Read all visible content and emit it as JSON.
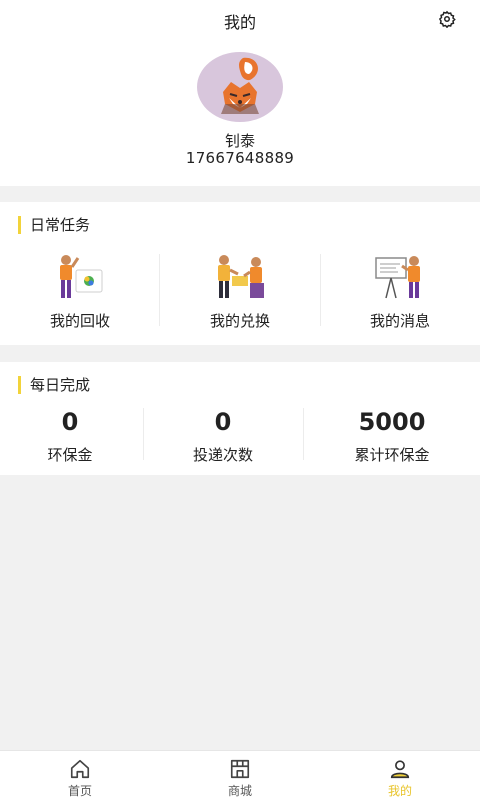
{
  "header": {
    "title": "我的",
    "username": "钊泰",
    "phone": "17667648889"
  },
  "tasks": {
    "section_title": "日常任务",
    "items": [
      {
        "label": "我的回收",
        "icon": "recycle-illustration-icon"
      },
      {
        "label": "我的兑换",
        "icon": "exchange-illustration-icon"
      },
      {
        "label": "我的消息",
        "icon": "message-illustration-icon"
      }
    ]
  },
  "daily": {
    "section_title": "每日完成",
    "stats": [
      {
        "value": "0",
        "label": "环保金"
      },
      {
        "value": "0",
        "label": "投递次数"
      },
      {
        "value": "5000",
        "label": "累计环保金"
      }
    ]
  },
  "tabbar": {
    "items": [
      {
        "label": "首页",
        "icon": "home-icon",
        "active": false
      },
      {
        "label": "商城",
        "icon": "shop-icon",
        "active": false
      },
      {
        "label": "我的",
        "icon": "user-icon",
        "active": true
      }
    ]
  },
  "colors": {
    "accent": "#f2d33a",
    "active_tab": "#e8c42a",
    "page_background": "#f1f1f1"
  }
}
